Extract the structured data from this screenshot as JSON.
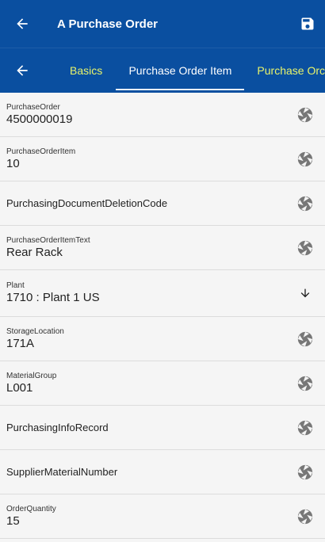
{
  "app_bar": {
    "title": "A Purchase Order",
    "back_icon": "arrow-left-icon",
    "save_icon": "save-icon"
  },
  "tabs": {
    "back_icon": "arrow-left-icon",
    "items": [
      {
        "label": "Basics"
      },
      {
        "label": "Purchase Order Item"
      },
      {
        "label": "Purchase Orc"
      }
    ]
  },
  "fields": [
    {
      "label": "PurchaseOrder",
      "value": "4500000019",
      "icon": "camera-shutter-icon"
    },
    {
      "label": "PurchaseOrderItem",
      "value": "10",
      "icon": "camera-shutter-icon"
    },
    {
      "label": "PurchasingDocumentDeletionCode",
      "icon": "camera-shutter-icon"
    },
    {
      "label": "PurchaseOrderItemText",
      "value": "Rear Rack",
      "icon": "camera-shutter-icon"
    },
    {
      "label": "Plant",
      "value": "1710 : Plant 1 US",
      "icon": "arrow-down-icon"
    },
    {
      "label": "StorageLocation",
      "value": "171A",
      "icon": "camera-shutter-icon"
    },
    {
      "label": "MaterialGroup",
      "value": "L001",
      "icon": "camera-shutter-icon"
    },
    {
      "label": "PurchasingInfoRecord",
      "icon": "camera-shutter-icon"
    },
    {
      "label": "SupplierMaterialNumber",
      "icon": "camera-shutter-icon"
    },
    {
      "label": "OrderQuantity",
      "value": "15",
      "icon": "camera-shutter-icon"
    }
  ],
  "colors": {
    "primary": "#0a4fa0",
    "tab_accent": "#e8f36a"
  }
}
